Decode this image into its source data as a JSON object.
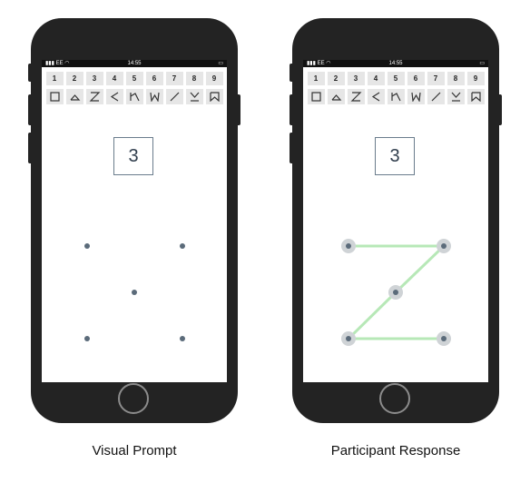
{
  "status_bar": {
    "carrier": "EE",
    "time": "14:55"
  },
  "number_keys": [
    "1",
    "2",
    "3",
    "4",
    "5",
    "6",
    "7",
    "8",
    "9"
  ],
  "glyph_keys": [
    "square-glyph-icon",
    "triangle-glyph-icon",
    "z-glyph-icon",
    "less-than-glyph-icon",
    "n-glyph-icon",
    "w-glyph-icon",
    "slash-glyph-icon",
    "m-arrow-glyph-icon",
    "bookmark-glyph-icon"
  ],
  "left_panel": {
    "prompt_number": "3",
    "caption": "Visual Prompt"
  },
  "right_panel": {
    "prompt_number": "3",
    "caption": "Participant Response"
  },
  "pattern": {
    "dots": 5,
    "shape": "Z"
  },
  "colors": {
    "phone": "#232323",
    "dot": "#5b6b7a",
    "dot_halo": "#cfd3d6",
    "trace": "#b7e8b7"
  }
}
